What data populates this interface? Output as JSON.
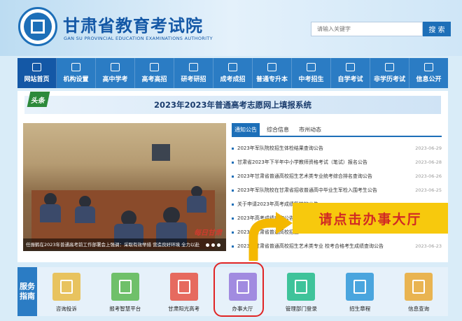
{
  "header": {
    "title": "甘肃省教育考试院",
    "subtitle": "GAN SU PROVINCIAL EDUCATION EXAMINATIONS AUTHORITY",
    "search_placeholder": "请输入关键字",
    "search_button": "搜 索"
  },
  "nav": {
    "items": [
      {
        "label": "网站首页",
        "icon": "home-icon"
      },
      {
        "label": "机构设置",
        "icon": "building-icon"
      },
      {
        "label": "高中学考",
        "icon": "person-icon"
      },
      {
        "label": "高考高招",
        "icon": "pencil-icon"
      },
      {
        "label": "研考研招",
        "icon": "graduation-cap-icon"
      },
      {
        "label": "成考成招",
        "icon": "book-icon"
      },
      {
        "label": "普通专升本",
        "icon": "screen-icon"
      },
      {
        "label": "中考招生",
        "icon": "people-icon"
      },
      {
        "label": "自学考试",
        "icon": "monitor-icon"
      },
      {
        "label": "非学历考试",
        "icon": "id-card-icon"
      },
      {
        "label": "信息公开",
        "icon": "envelope-icon"
      }
    ]
  },
  "headline": {
    "tag": "头条",
    "title": "2023年2023年普通高考志愿网上填报系统"
  },
  "photo": {
    "caption": "任振鹤在2023年普通高考前工作部署会上强调：采取有效举措 营造良好环境 全力以赴",
    "watermark": "每日甘肃"
  },
  "tabs": {
    "items": [
      "通知公告",
      "综合信息",
      "市州动态"
    ]
  },
  "news": [
    {
      "title": "2023年军队院校招生体检结果查询公告",
      "date": "2023-06-29"
    },
    {
      "title": "甘肃省2023年下半年中小学教师资格考试（笔试）报名公告",
      "date": "2023-06-28"
    },
    {
      "title": "2023年甘肃省普通高校招生艺术类专业统考综合排名查询公告",
      "date": "2023-06-26"
    },
    {
      "title": "2023年军队院校在甘肃省招收普通高中毕业生军检入围考生公告",
      "date": "2023-06-25"
    },
    {
      "title": "关于申请2023年高考成绩复核的公告",
      "date": ""
    },
    {
      "title": "2023年高考成绩查询公告",
      "date": ""
    },
    {
      "title": "2023年甘肃省普通高校招生",
      "date": ""
    },
    {
      "title": "2023年甘肃省普通高校招生艺术类专业 校考合格考生成绩查询公告",
      "date": "2023-06-23"
    }
  ],
  "callout": {
    "text": "请点击办事大厅"
  },
  "services": {
    "label_line1": "服务",
    "label_line2": "指南",
    "items": [
      {
        "label": "咨询投诉",
        "color": "#e8c35f",
        "icon": "pen-paper-icon"
      },
      {
        "label": "报考智慧平台",
        "color": "#6fc06a",
        "icon": "document-icon"
      },
      {
        "label": "甘肃阳光高考",
        "color": "#e66a5f",
        "icon": "list-icon"
      },
      {
        "label": "办事大厅",
        "color": "#a18be0",
        "icon": "form-icon"
      },
      {
        "label": "管理部门登录",
        "color": "#3fc39a",
        "icon": "hierarchy-icon"
      },
      {
        "label": "招生章程",
        "color": "#4aa5de",
        "icon": "file-icon"
      },
      {
        "label": "信息查询",
        "color": "#e9b451",
        "icon": "refresh-icon"
      }
    ]
  }
}
